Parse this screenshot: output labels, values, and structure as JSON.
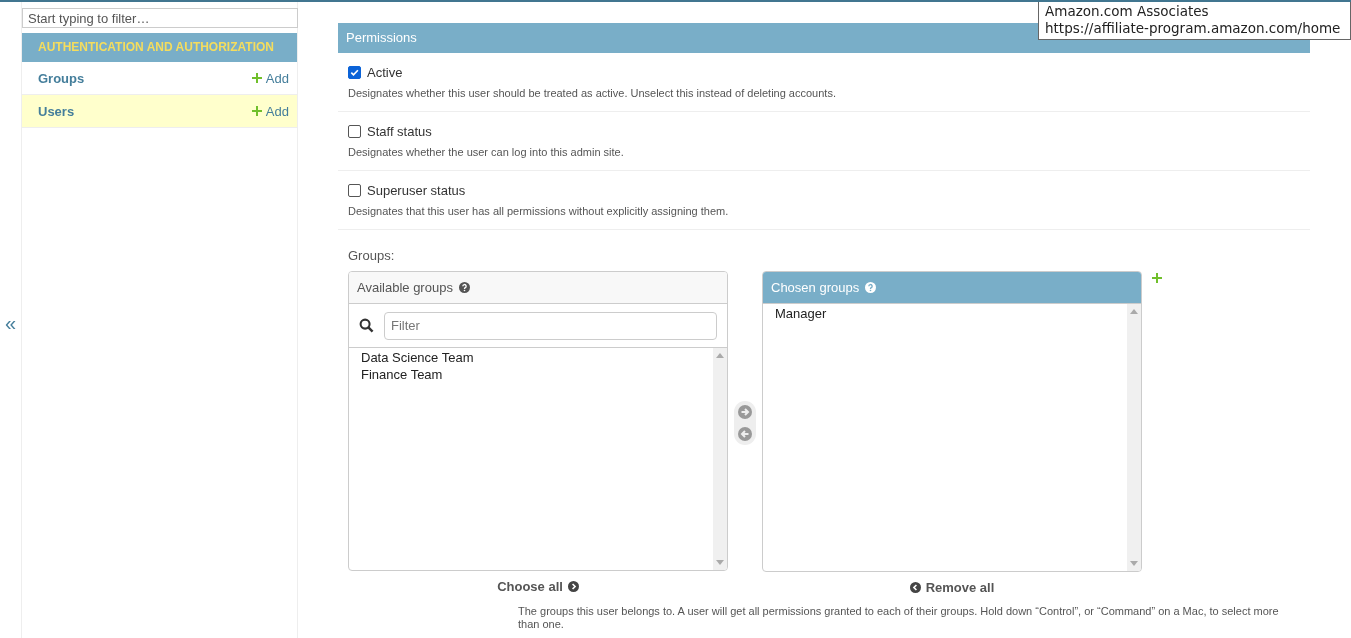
{
  "sidebar": {
    "filter_placeholder": "Start typing to filter…",
    "toggle": "«",
    "app": {
      "title": "AUTHENTICATION AND AUTHORIZATION",
      "models": [
        {
          "name": "Groups",
          "add": "Add",
          "selected": false
        },
        {
          "name": "Users",
          "add": "Add",
          "selected": true
        }
      ]
    }
  },
  "fieldset": {
    "title": "Permissions",
    "checkboxes": [
      {
        "label": "Active",
        "checked": true,
        "help": "Designates whether this user should be treated as active. Unselect this instead of deleting accounts."
      },
      {
        "label": "Staff status",
        "checked": false,
        "help": "Designates whether the user can log into this admin site."
      },
      {
        "label": "Superuser status",
        "checked": false,
        "help": "Designates that this user has all permissions without explicitly assigning them."
      }
    ],
    "groups": {
      "label": "Groups:",
      "available": {
        "title": "Available groups",
        "filter_placeholder": "Filter",
        "items": [
          "Data Science Team",
          "Finance Team"
        ],
        "action": "Choose all"
      },
      "chosen": {
        "title": "Chosen groups",
        "items": [
          "Manager"
        ],
        "action": "Remove all"
      },
      "help": "The groups this user belongs to. A user will get all permissions granted to each of their groups. Hold down “Control”, or “Command” on a Mac, to select more than one."
    }
  },
  "tooltip": {
    "lines": [
      "Amazon.com Associates",
      "https://affiliate-program.amazon.com/home"
    ]
  }
}
